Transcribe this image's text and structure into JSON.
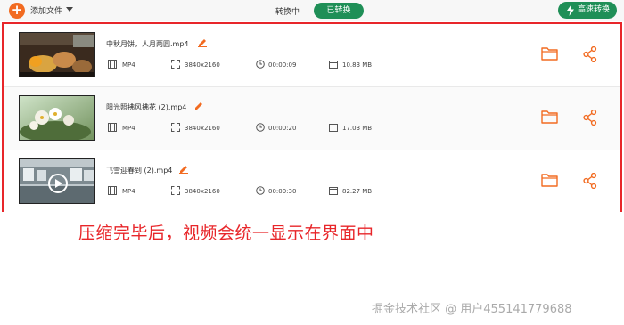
{
  "toolbar": {
    "add_label": "添加文件",
    "tab_converting": "转换中",
    "tab_converted": "已转换",
    "fast_label": "高速转换"
  },
  "files": [
    {
      "name": "中秋月饼，人月两圆.mp4",
      "format": "MP4",
      "resolution": "3840x2160",
      "duration": "00:00:09",
      "size": "10.83 MB"
    },
    {
      "name": "阳光照拂风拂花 (2).mp4",
      "format": "MP4",
      "resolution": "3840x2160",
      "duration": "00:00:20",
      "size": "17.03 MB"
    },
    {
      "name": "飞雪迎春到 (2).mp4",
      "format": "MP4",
      "resolution": "3840x2160",
      "duration": "00:00:30",
      "size": "82.27 MB"
    }
  ],
  "annotation": "压缩完毕后，视频会统一显示在界面中",
  "watermark": "掘金技术社区 @ 用户455141779688",
  "colors": {
    "accent_green": "#1f8f57",
    "accent_orange": "#f26b21",
    "highlight_red": "#e8262a"
  },
  "icons": {
    "add": "plus-circle-icon",
    "dropdown": "caret-down-icon",
    "fast": "lightning-icon",
    "edit": "pencil-icon",
    "format": "film-icon",
    "resolution": "expand-icon",
    "duration": "clock-icon",
    "size": "file-icon",
    "folder": "folder-icon",
    "share": "share-icon"
  }
}
